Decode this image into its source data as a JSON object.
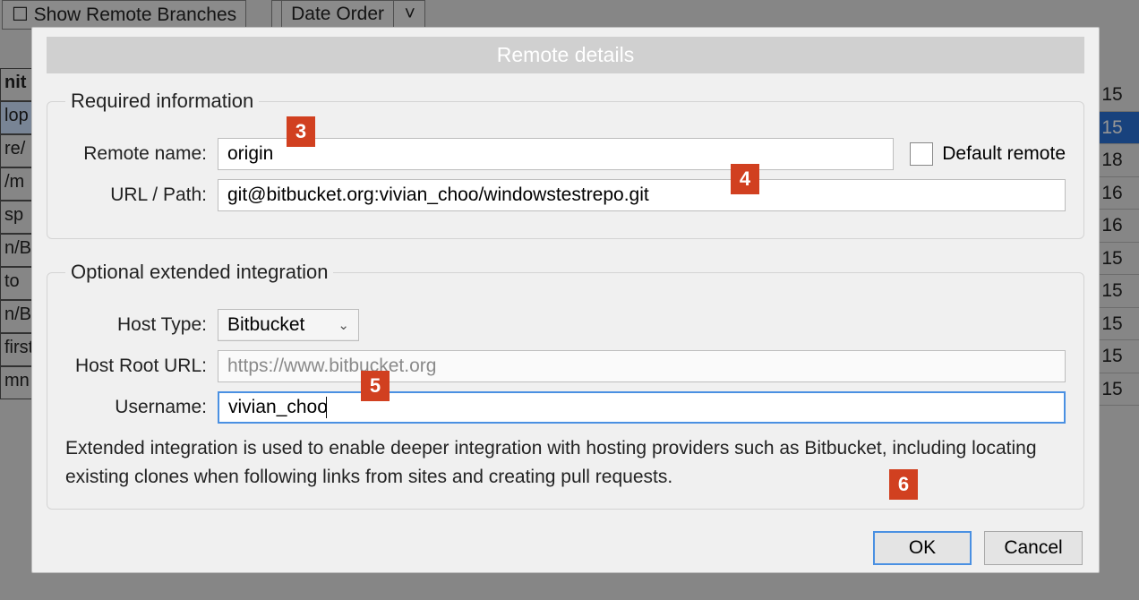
{
  "backdrop": {
    "show_remote": "Show Remote Branches",
    "date_order": "Date Order",
    "numbers": [
      "15",
      "15",
      "18",
      "16",
      "16",
      "15",
      "15",
      "15",
      "15",
      "15"
    ],
    "leftcol": [
      "nit",
      "lop",
      "re/",
      "/m",
      "sp",
      "n/B",
      "to",
      "n/B",
      "first",
      "mn"
    ]
  },
  "dialog": {
    "title": "Remote details",
    "required": {
      "legend": "Required information",
      "remote_name_label": "Remote name:",
      "remote_name_value": "origin",
      "default_remote_label": "Default remote",
      "url_label": "URL / Path:",
      "url_value": "git@bitbucket.org:vivian_choo/windowstestrepo.git"
    },
    "optional": {
      "legend": "Optional extended integration",
      "host_type_label": "Host Type:",
      "host_type_value": "Bitbucket",
      "host_root_label": "Host Root URL:",
      "host_root_value": "https://www.bitbucket.org",
      "username_label": "Username:",
      "username_value": "vivian_choo",
      "help": "Extended integration is used to enable deeper integration with hosting providers such as Bitbucket, including locating existing clones when following links from sites and creating pull requests."
    },
    "buttons": {
      "ok": "OK",
      "cancel": "Cancel"
    }
  },
  "badges": {
    "b3": "3",
    "b4": "4",
    "b5": "5",
    "b6": "6"
  }
}
